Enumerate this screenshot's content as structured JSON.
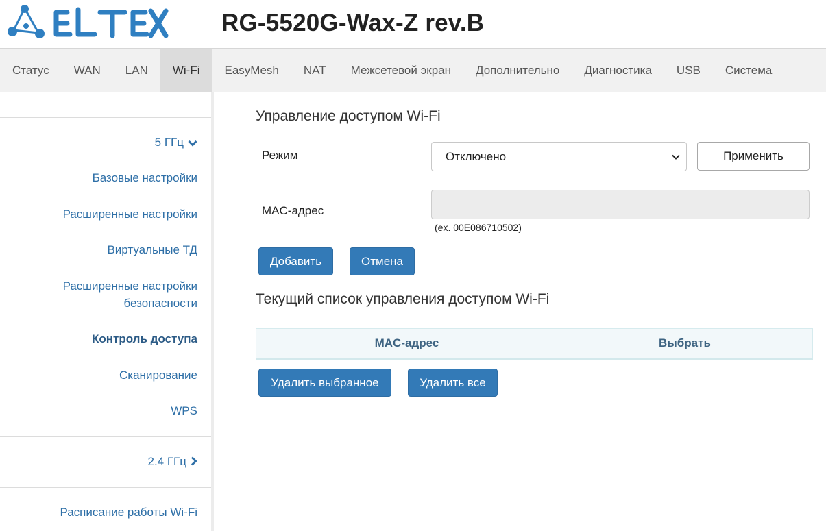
{
  "header": {
    "logo_text": "ELTEX",
    "device_title": "RG-5520G-Wax-Z rev.B",
    "brand_color": "#2f7fc1"
  },
  "topnav": {
    "items": [
      "Статус",
      "WAN",
      "LAN",
      "Wi-Fi",
      "EasyMesh",
      "NAT",
      "Межсетевой экран",
      "Дополнительно",
      "Диагностика",
      "USB",
      "Система"
    ],
    "active": "Wi-Fi"
  },
  "sidebar": {
    "band_5": "5 ГГц",
    "items": [
      "Базовые настройки",
      "Расширенные настройки",
      "Виртуальные ТД",
      "Расширенные настройки безопасности",
      "Контроль доступа",
      "Сканирование",
      "WPS"
    ],
    "active": "Контроль доступа",
    "band_24": "2.4 ГГц",
    "schedule": "Расписание работы Wi-Fi"
  },
  "access_control": {
    "title": "Управление доступом Wi-Fi",
    "mode_label": "Режим",
    "mode_value": "Отключено",
    "apply_label": "Применить",
    "mac_label": "MAC-адрес",
    "mac_value": "",
    "mac_hint": "(ex. 00E086710502)",
    "add_label": "Добавить",
    "cancel_label": "Отмена"
  },
  "current_list": {
    "title": "Текущий список управления доступом Wi-Fi",
    "columns": [
      "MAC-адрес",
      "Выбрать"
    ],
    "rows": [],
    "delete_selected_label": "Удалить выбранное",
    "delete_all_label": "Удалить все"
  },
  "colors": {
    "primary_button": "#337ab7",
    "link": "#2e6fa7",
    "nav_background": "#f1f1f1",
    "nav_active": "#dcdcdc"
  }
}
